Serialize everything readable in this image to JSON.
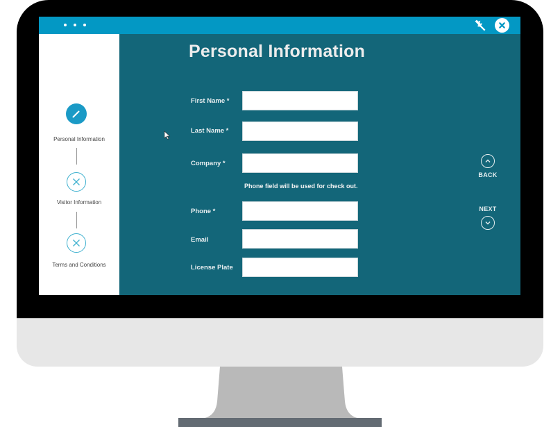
{
  "app": {
    "topbar": {
      "menu_icon": "more-dots-icon",
      "settings_icon": "wrench-icon",
      "close_icon": "close-circle-icon"
    }
  },
  "sidebar": {
    "steps": [
      {
        "label": "Personal Information",
        "state": "active",
        "icon": "pencil-icon"
      },
      {
        "label": "Visitor Information",
        "state": "incomplete",
        "icon": "x-icon"
      },
      {
        "label": "Terms and Conditions",
        "state": "incomplete",
        "icon": "x-icon"
      }
    ]
  },
  "main": {
    "title": "Personal Information",
    "phone_note": "Phone field will be used for check out.",
    "fields": [
      {
        "label": "First Name *",
        "value": "",
        "placeholder": ""
      },
      {
        "label": "Last Name *",
        "value": "",
        "placeholder": ""
      },
      {
        "label": "Company *",
        "value": "",
        "placeholder": ""
      },
      {
        "label": "Phone *",
        "value": "",
        "placeholder": ""
      },
      {
        "label": "Email",
        "value": "",
        "placeholder": ""
      },
      {
        "label": "License Plate",
        "value": "",
        "placeholder": ""
      }
    ],
    "nav": {
      "back_label": "BACK",
      "next_label": "NEXT"
    }
  },
  "colors": {
    "topbar": "#0398c4",
    "main_bg": "#136679",
    "accent": "#1a9ac6",
    "step_outline": "#3fb1cf",
    "bezel": "#000000",
    "chin": "#e7e7e7",
    "stand": "#b9b9b9",
    "base": "#636b73"
  }
}
